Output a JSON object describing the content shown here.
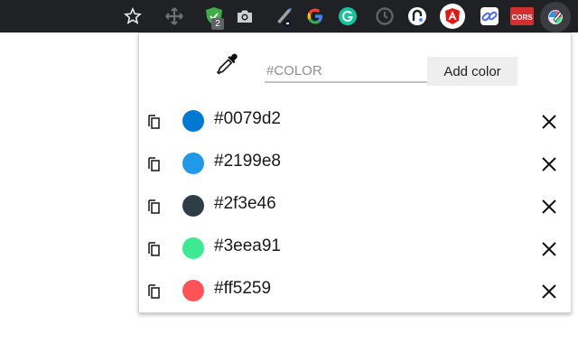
{
  "toolbar": {
    "icons": [
      "star-icon",
      "move-icon",
      "shield-extension-icon",
      "camera-icon",
      "pen-extension-icon",
      "google-icon",
      "grammarly-icon",
      "clock-icon",
      "translate-icon",
      "angular-icon",
      "link-extension-icon",
      "cors-extension-icon",
      "color-picker-extension-icon"
    ],
    "shield_badge": "2",
    "cors_label": "CORS",
    "google_letter": "G",
    "background": "#202124"
  },
  "popup": {
    "input": {
      "placeholder": "#COLOR",
      "value": ""
    },
    "add_button_label": "Add color",
    "colors": [
      {
        "label": "#0079d2",
        "swatch": "#0079d2"
      },
      {
        "label": "#2199e8",
        "swatch": "#2199e8"
      },
      {
        "label": "#2f3e46",
        "swatch": "#2f3e46"
      },
      {
        "label": "#3eea91",
        "swatch": "#3eea91"
      },
      {
        "label": "#ff5259",
        "swatch": "#ff5259"
      }
    ]
  }
}
